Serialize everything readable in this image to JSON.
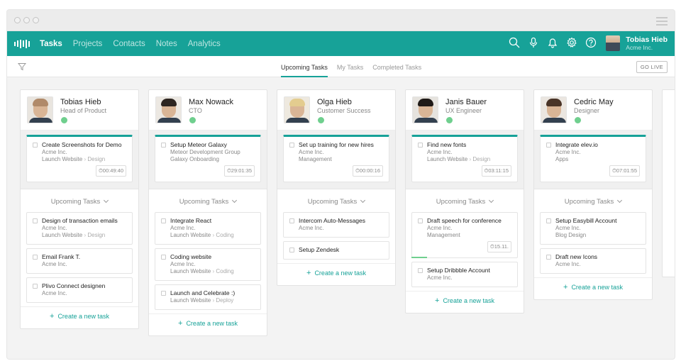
{
  "nav": {
    "links": [
      {
        "label": "Tasks",
        "active": true
      },
      {
        "label": "Projects",
        "active": false
      },
      {
        "label": "Contacts",
        "active": false
      },
      {
        "label": "Notes",
        "active": false
      },
      {
        "label": "Analytics",
        "active": false
      }
    ],
    "icons": [
      "search-icon",
      "microphone-icon",
      "bell-icon",
      "gear-icon",
      "help-icon"
    ],
    "user": {
      "name": "Tobias Hieb",
      "company": "Acme Inc."
    }
  },
  "subnav": {
    "tabs": [
      "Upcoming Tasks",
      "My Tasks",
      "Completed Tasks"
    ],
    "active_tab": "Upcoming Tasks",
    "go_live": "GO LIVE"
  },
  "colors": {
    "accent": "#17a298",
    "online": "#6fcf8e"
  },
  "columns": [
    {
      "name": "Tobias Hieb",
      "role": "Head of Product",
      "current": {
        "title": "Create Screenshots for Demo",
        "company": "Acme Inc.",
        "project": "Launch Website",
        "sub": "Design",
        "timer": "00:49:40"
      },
      "upcoming_label": "Upcoming Tasks",
      "tasks": [
        {
          "title": "Design of transaction emails",
          "company": "Acme Inc.",
          "project": "Launch Website",
          "sub": "Design"
        },
        {
          "title": "Email Frank T.",
          "company": "Acme Inc."
        },
        {
          "title": "Plivo Connect designen",
          "company": "Acme Inc."
        }
      ],
      "create": "Create a new task"
    },
    {
      "name": "Max Nowack",
      "role": "CTO",
      "current": {
        "title": "Setup Meteor Galaxy",
        "company": "Meteor Development Group",
        "project": "Galaxy Onboarding",
        "timer": "29:01:35"
      },
      "upcoming_label": "Upcoming Tasks",
      "tasks": [
        {
          "title": "Integrate React",
          "company": "Acme Inc.",
          "project": "Launch Website",
          "sub": "Coding"
        },
        {
          "title": "Coding website",
          "company": "Acme Inc.",
          "project": "Launch Website",
          "sub": "Coding"
        },
        {
          "title": "Launch and Celebrate :)",
          "project": "Launch Website",
          "sub": "Deploy"
        }
      ],
      "create": "Create a new task"
    },
    {
      "name": "Olga Hieb",
      "role": "Customer Success",
      "current": {
        "title": "Set up training for new hires",
        "company": "Acme Inc.",
        "project": "Management",
        "timer": "00:00:16"
      },
      "upcoming_label": "Upcoming Tasks",
      "tasks": [
        {
          "title": "Intercom Auto-Messages",
          "company": "Acme Inc."
        },
        {
          "title": "Setup Zendesk"
        }
      ],
      "create": "Create a new task"
    },
    {
      "name": "Janis Bauer",
      "role": "UX Engineer",
      "current": {
        "title": "Find new fonts",
        "company": "Acme Inc.",
        "project": "Launch Website",
        "sub": "Design",
        "timer": "03:11:15"
      },
      "upcoming_label": "Upcoming Tasks",
      "tasks": [
        {
          "title": "Draft speech for conference",
          "company": "Acme Inc.",
          "project": "Management",
          "timer": "15.11."
        },
        {
          "title": "Setup Dribbble Account",
          "company": "Acme Inc."
        }
      ],
      "create": "Create a new task"
    },
    {
      "name": "Cedric May",
      "role": "Designer",
      "current": {
        "title": "Integrate elev.io",
        "company": "Acme Inc.",
        "project": "Apps",
        "timer": "07:01:55"
      },
      "upcoming_label": "Upcoming Tasks",
      "tasks": [
        {
          "title": "Setup Easybill Account",
          "company": "Acme Inc.",
          "project": "Blog Design"
        },
        {
          "title": "Draft new Icons",
          "company": "Acme Inc."
        }
      ],
      "create": "Create a new task"
    }
  ]
}
